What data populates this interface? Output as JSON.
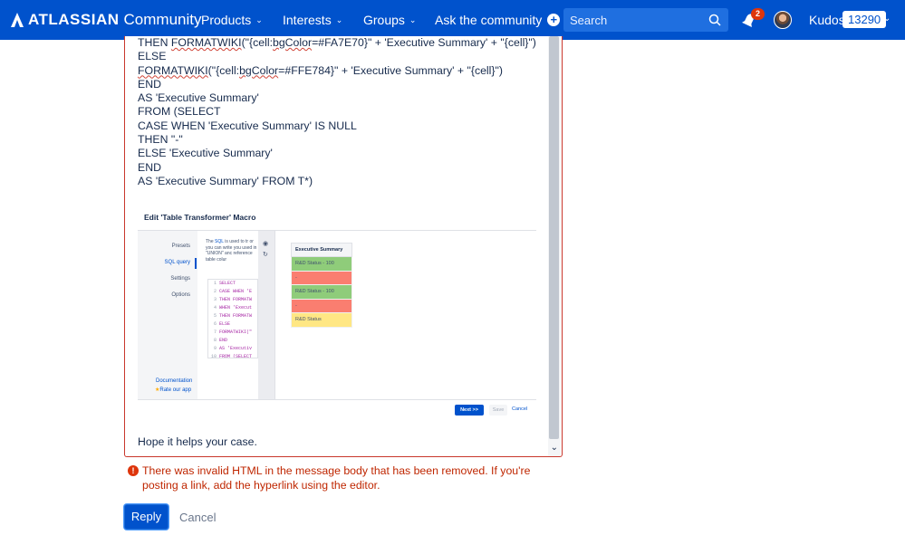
{
  "nav": {
    "brand": "ATLASSIAN",
    "community": "Community",
    "items": [
      {
        "label": "Products"
      },
      {
        "label": "Interests"
      },
      {
        "label": "Groups"
      }
    ],
    "ask": "Ask the community",
    "search_placeholder": "Search",
    "notification_count": "2",
    "kudos_label": "Kudos",
    "kudos_count": "13290"
  },
  "editor": {
    "lines": [
      {
        "pre": "THEN ",
        "fn": "FORMATWIKI",
        "mid": "(\"{cell:",
        "sq": "bgColor",
        "post": "=#FA7E70}\" + 'Executive Summary' + \"{cell}\")"
      },
      {
        "pre": "ELSE"
      },
      {
        "pre": "",
        "fn": "FORMATWIKI",
        "mid": "(\"{cell:",
        "sq": "bgColor",
        "post": "=#FFE784}\" + 'Executive Summary' + \"{cell}\")"
      },
      {
        "pre": "END"
      },
      {
        "pre": "AS 'Executive Summary'"
      },
      {
        "pre": "FROM (SELECT"
      },
      {
        "pre": "CASE WHEN 'Executive Summary' IS NULL"
      },
      {
        "pre": "THEN \"-\""
      },
      {
        "pre": "ELSE 'Executive Summary'"
      },
      {
        "pre": "END"
      },
      {
        "pre": "AS 'Executive Summary' FROM T*)"
      }
    ],
    "closing": "Hope it helps your case."
  },
  "embed": {
    "title": "Edit 'Table Transformer' Macro",
    "side_items": [
      "Presets",
      "SQL query",
      "Settings",
      "Options"
    ],
    "documentation": "Documentation",
    "rate": "Rate our app",
    "desc_pre": "The ",
    "desc_link": "SQL",
    "desc_post": " is used to tr or you can write you used in \"UNION\" anc reference table colur",
    "code_lines": [
      {
        "n": "1",
        "t": "SELECT"
      },
      {
        "n": "2",
        "t": "CASE WHEN 'E"
      },
      {
        "n": "3",
        "t": "THEN FORMATW"
      },
      {
        "n": "4",
        "t": "WHEN 'Execut"
      },
      {
        "n": "5",
        "t": "THEN FORMATW"
      },
      {
        "n": "6",
        "t": "ELSE"
      },
      {
        "n": "7",
        "t": "FORMATWIKI(\""
      },
      {
        "n": "8",
        "t": "END"
      },
      {
        "n": "9",
        "t": "AS 'Executiv"
      },
      {
        "n": "10",
        "t": "FROM (SELECT"
      }
    ],
    "table_header": "Executive Summary",
    "rows": [
      {
        "text": "R&D Status - 100",
        "color": "#8fcc7a"
      },
      {
        "text": "-",
        "color": "#fa7e70"
      },
      {
        "text": "R&D Status - 100",
        "color": "#8fcc7a"
      },
      {
        "text": "-",
        "color": "#fa7e70"
      },
      {
        "text": "R&D Status",
        "color": "#ffe784"
      }
    ],
    "next": "Next >>",
    "save": "Save",
    "cancel": "Cancel"
  },
  "error": "There was invalid HTML in the message body that has been removed. If you're posting a link, add the hyperlink using the editor.",
  "actions": {
    "reply": "Reply",
    "cancel": "Cancel"
  },
  "colors": {
    "nav_bg": "#0052cc",
    "error": "#bf2600",
    "accent": "#0052cc"
  }
}
